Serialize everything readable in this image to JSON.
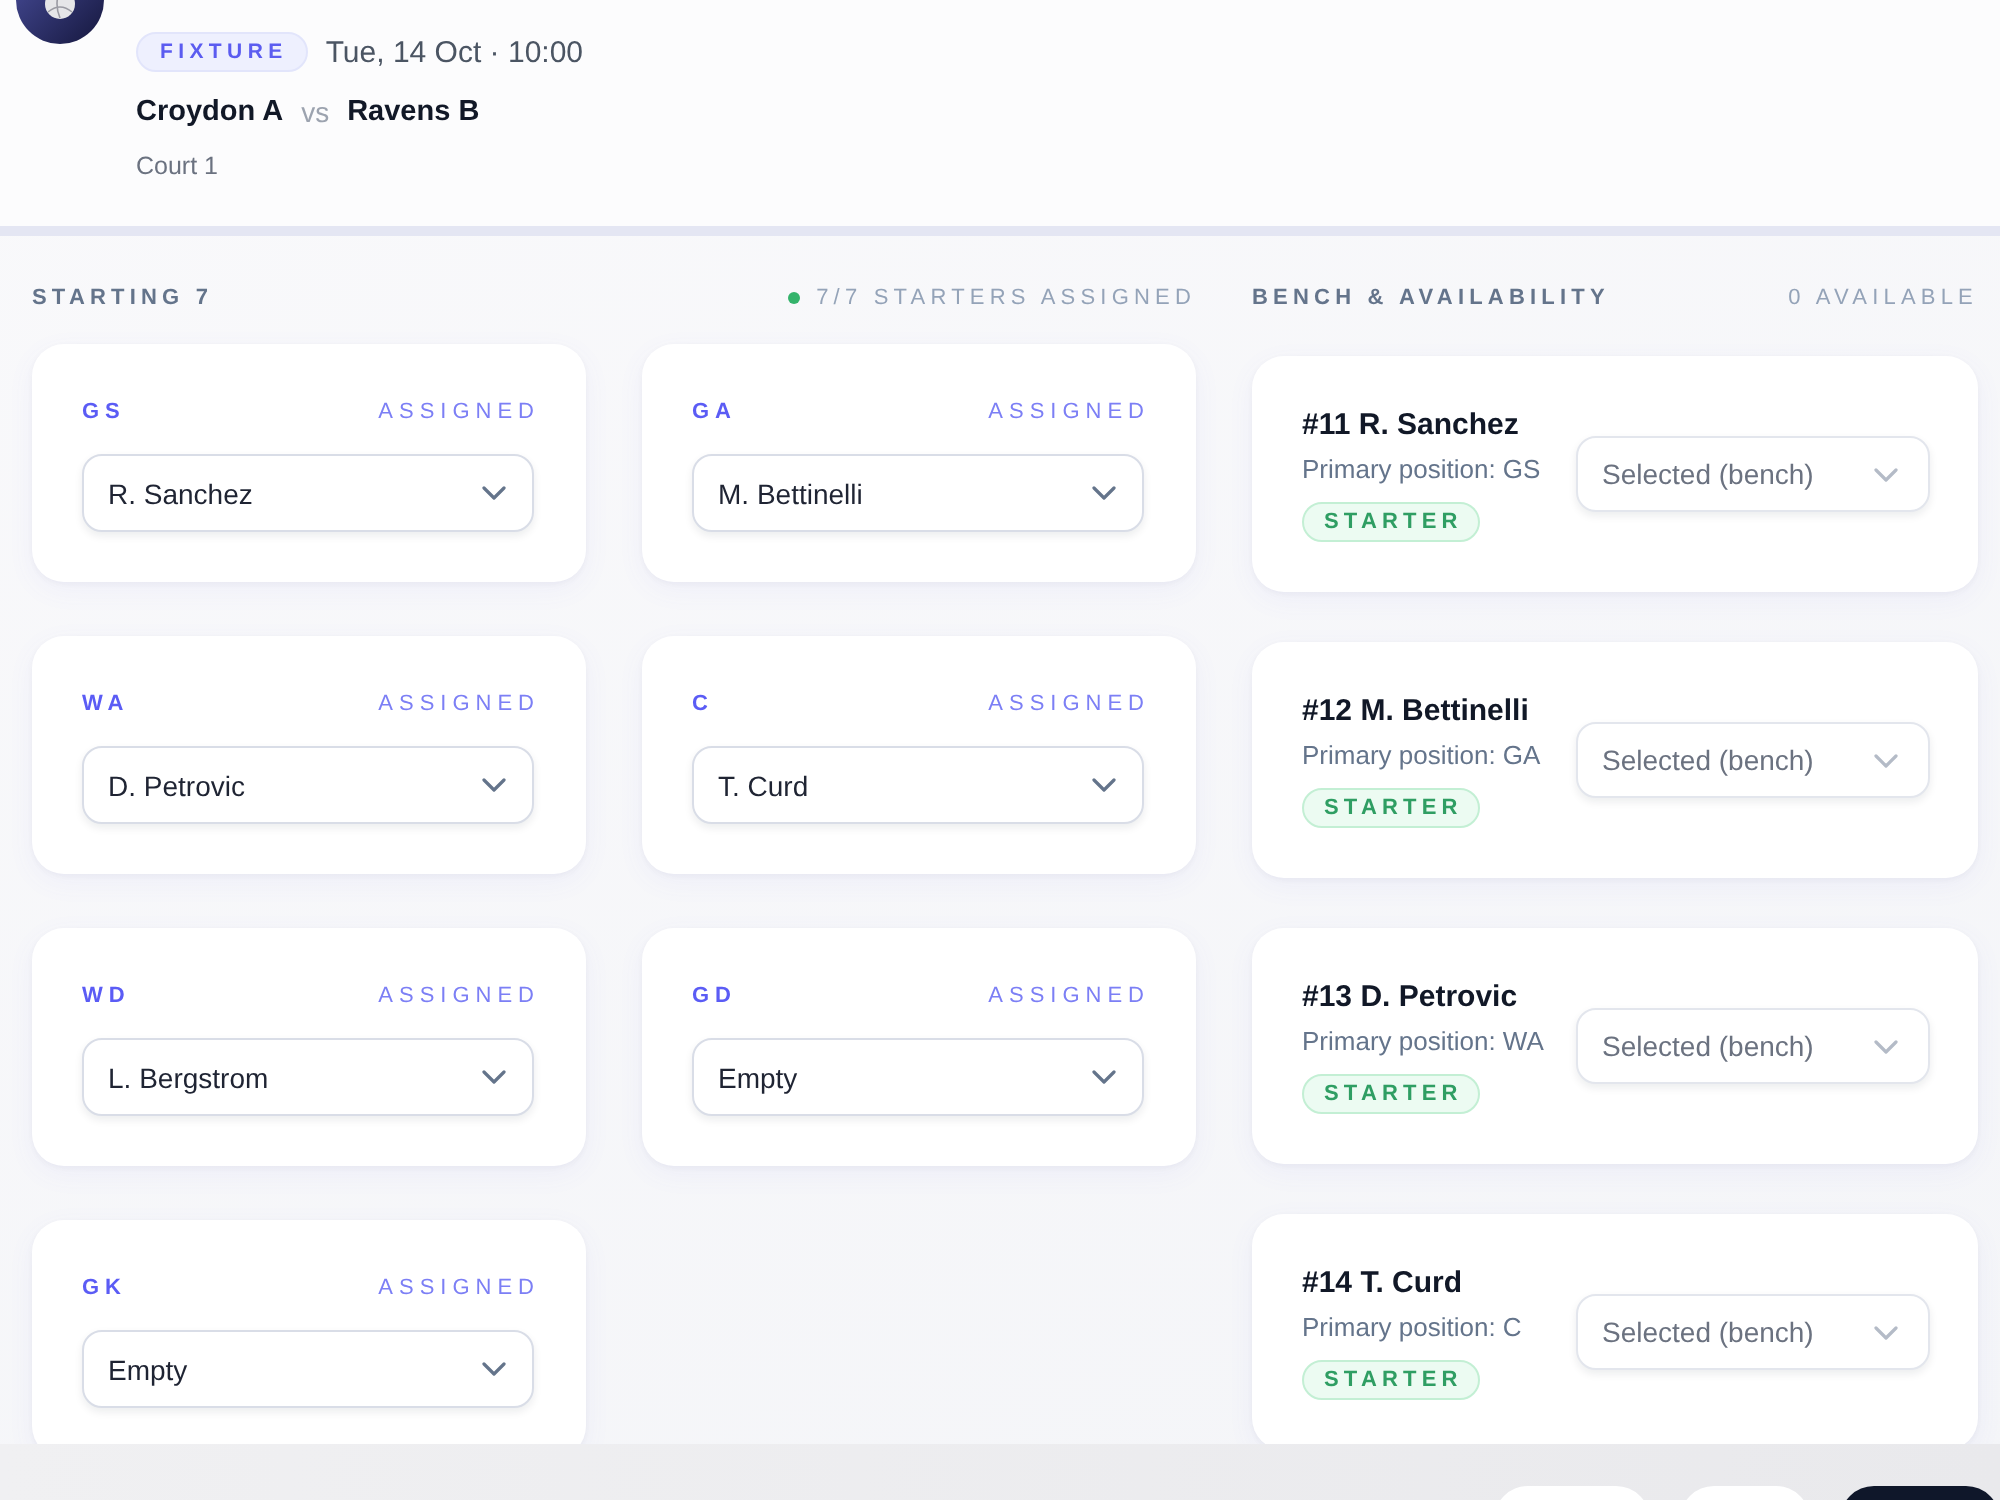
{
  "fixture": {
    "badge": "FIXTURE",
    "datetime": "Tue, 14 Oct · 10:00",
    "home": "Croydon A",
    "vs": "vs",
    "away": "Ravens B",
    "venue": "Court 1"
  },
  "starting": {
    "title": "STARTING 7",
    "status": "7/7 STARTERS ASSIGNED",
    "positions": [
      {
        "code": "GS",
        "status": "ASSIGNED",
        "player": "R. Sanchez"
      },
      {
        "code": "GA",
        "status": "ASSIGNED",
        "player": "M. Bettinelli"
      },
      {
        "code": "WA",
        "status": "ASSIGNED",
        "player": "D. Petrovic"
      },
      {
        "code": "C",
        "status": "ASSIGNED",
        "player": "T. Curd"
      },
      {
        "code": "WD",
        "status": "ASSIGNED",
        "player": "L. Bergstrom"
      },
      {
        "code": "GD",
        "status": "ASSIGNED",
        "player": "Empty"
      },
      {
        "code": "GK",
        "status": "ASSIGNED",
        "player": "Empty"
      }
    ]
  },
  "bench": {
    "title": "BENCH & AVAILABILITY",
    "count": "0 AVAILABLE",
    "players": [
      {
        "name": "#11 R. Sanchez",
        "position": "Primary position: GS",
        "tag": "STARTER",
        "selection": "Selected (bench)"
      },
      {
        "name": "#12 M. Bettinelli",
        "position": "Primary position: GA",
        "tag": "STARTER",
        "selection": "Selected (bench)"
      },
      {
        "name": "#13 D. Petrovic",
        "position": "Primary position: WA",
        "tag": "STARTER",
        "selection": "Selected (bench)"
      },
      {
        "name": "#14 T. Curd",
        "position": "Primary position: C",
        "tag": "STARTER",
        "selection": "Selected (bench)"
      }
    ]
  }
}
